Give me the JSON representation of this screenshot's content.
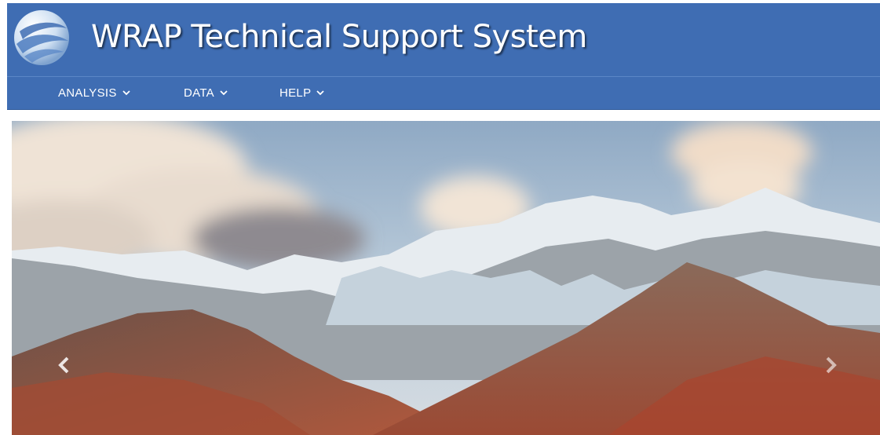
{
  "header": {
    "title": "WRAP Technical Support System",
    "background_color": "#3f6db3",
    "logo_icon": "swirl-globe-icon"
  },
  "nav": {
    "items": [
      {
        "label": "ANALYSIS",
        "icon": "chevron-down-icon"
      },
      {
        "label": "DATA",
        "icon": "chevron-down-icon"
      },
      {
        "label": "HELP",
        "icon": "chevron-down-icon"
      }
    ]
  },
  "carousel": {
    "image": "mountain-landscape-photo",
    "prev_icon": "chevron-left-icon",
    "next_icon": "chevron-right-icon"
  }
}
